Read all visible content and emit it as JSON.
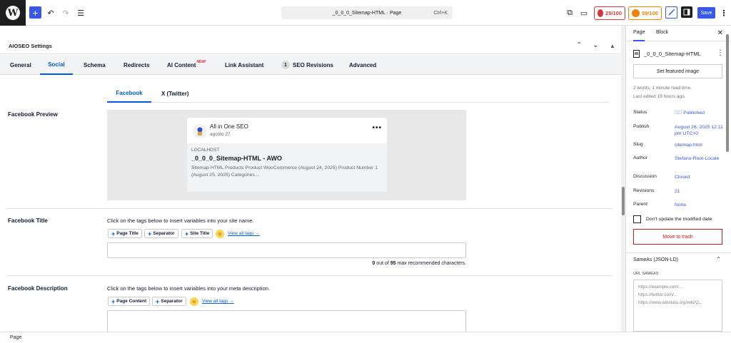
{
  "topbar": {
    "add_label": "+",
    "undo_icon": "↶",
    "redo_icon": "↷",
    "list_icon": "☰",
    "command_title": "_0_0_0_Sitemap-HTML · Page",
    "command_shortcut": "Ctrl+K",
    "view_icon": "⧉",
    "desktop_icon": "▭",
    "seo_score": "25/100",
    "truseo_score": "59/100",
    "save_label": "Save",
    "colors": {
      "accent": "#3858e9",
      "score_red": "#d63638",
      "score_orange": "#f18200"
    }
  },
  "aioseo": {
    "title": "AIOSEO Settings",
    "tabs": [
      {
        "label": "General"
      },
      {
        "label": "Social"
      },
      {
        "label": "Schema"
      },
      {
        "label": "Redirects"
      },
      {
        "label": "AI Content",
        "badge": "NEW!"
      },
      {
        "label": "Link Assistant"
      },
      {
        "label": "SEO Revisions",
        "count": "1"
      },
      {
        "label": "Advanced"
      }
    ],
    "subtabs": [
      "Facebook",
      "X (Twitter)"
    ],
    "facebook_preview": {
      "label": "Facebook Preview",
      "site_name": "All in One SEO",
      "date": "agosto 27",
      "domain": "LOCALHOST",
      "title": "_0_0_0_Sitemap-HTML - AWO",
      "description": "Sitemap HTML Products Product WooCommerce (August 24, 2025) Product Number 1 (August 25, 2025) Categories…"
    },
    "facebook_title": {
      "label": "Facebook Title",
      "hint": "Click on the tags below to insert variables into your site name.",
      "tags": [
        "Page Title",
        "Separator",
        "Site Title"
      ],
      "view_all": "View all tags →",
      "count": "0",
      "max": "95",
      "counter_mid": " out of ",
      "counter_tail": " max recommended characters."
    },
    "facebook_description": {
      "label": "Facebook Description",
      "hint": "Click on the tags below to insert variables into your meta description.",
      "tags": [
        "Page Content",
        "Separator"
      ],
      "view_all": "View all tags →"
    }
  },
  "sidebar": {
    "tabs": [
      "Page",
      "Block"
    ],
    "doc_title": "_0_0_0_Sitemap-HTML",
    "featured_image": "Set featured image",
    "read_time": "2 words, 1 minute read time.",
    "last_edited": "Last edited 18 hours ago.",
    "meta": [
      {
        "key": "Status",
        "value": "Published"
      },
      {
        "key": "Publish",
        "value": "August 26, 2025 12:11 pm UTC+0"
      },
      {
        "key": "Slug",
        "value": "sitemap-html"
      },
      {
        "key": "Author",
        "value": "Stefano-Root-Locale"
      },
      {
        "key": "Discussion",
        "value": "Closed"
      },
      {
        "key": "Revisions",
        "value": "21"
      },
      {
        "key": "Parent",
        "value": "None"
      }
    ],
    "modified_checkbox": "Don't update the modified date",
    "trash": "Move to trash",
    "sameas_title": "SameAs (JSON-LD)",
    "url_label": "URL SAMEAS",
    "url_placeholder_lines": [
      "https://example.com/...",
      "https://twitter.com/...",
      "https://www.wikidata.org/wiki/Q..."
    ]
  },
  "statusbar": {
    "label": "Page"
  }
}
